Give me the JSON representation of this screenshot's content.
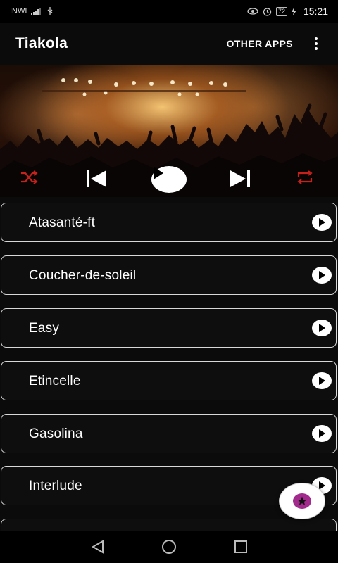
{
  "status_bar": {
    "carrier": "INWI",
    "battery": "72",
    "time": "15:21"
  },
  "app_bar": {
    "title": "Tiakola",
    "other_apps_label": "OTHER APPS"
  },
  "songs": [
    {
      "title": "Atasanté-ft"
    },
    {
      "title": "Coucher-de-soleil"
    },
    {
      "title": "Easy"
    },
    {
      "title": "Etincelle"
    },
    {
      "title": "Gasolina"
    },
    {
      "title": "Interlude"
    },
    {
      "title": ""
    }
  ],
  "colors": {
    "accent_red": "#c8201a",
    "fab_star": "#a12a8c"
  },
  "icons": {
    "shuffle": "shuffle-icon",
    "previous": "skip-previous-icon",
    "play": "play-icon",
    "next": "skip-next-icon",
    "repeat": "repeat-icon",
    "fab": "star-icon"
  }
}
